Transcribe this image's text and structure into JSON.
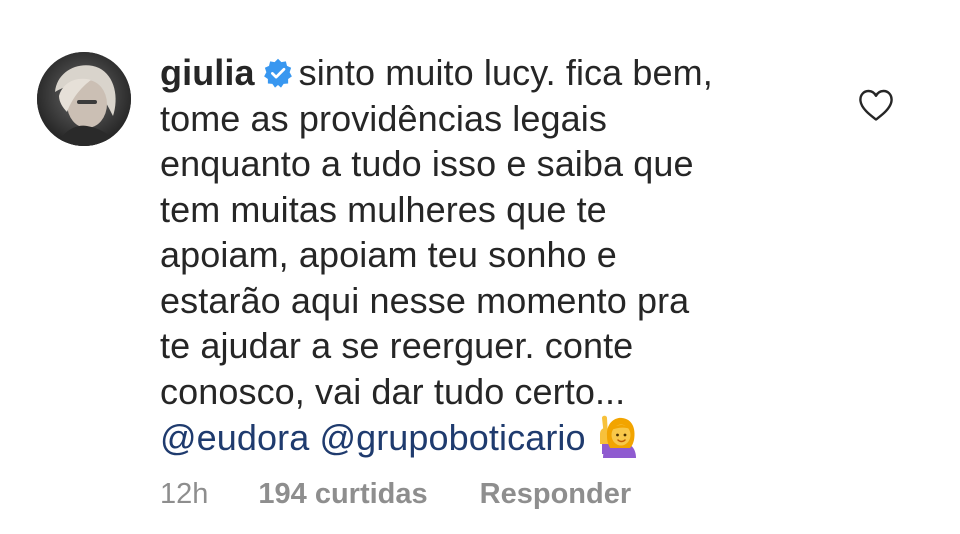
{
  "comment": {
    "username": "giulia",
    "lines": [
      "sinto muito lucy. fica bem,",
      "tome as providências legais",
      "enquanto a tudo isso e saiba que",
      "tem muitas mulheres que te",
      "apoiam, apoiam teu sonho e",
      "estarão aqui nesse momento pra",
      "te ajudar a se reerguer.  conte",
      "conosco, vai dar tudo certo..."
    ],
    "mentions": [
      "@eudora",
      "@grupoboticario"
    ],
    "timestamp": "12h",
    "likes_label": "194 curtidas",
    "reply_label": "Responder"
  },
  "icons": {
    "verified": "verified-badge-icon",
    "like": "heart-outline-icon",
    "emoji": "person-raising-hand-emoji"
  },
  "colors": {
    "text": "#262626",
    "muted": "#8e8e8e",
    "mention": "#1f3b6e",
    "verified": "#3897f0"
  }
}
